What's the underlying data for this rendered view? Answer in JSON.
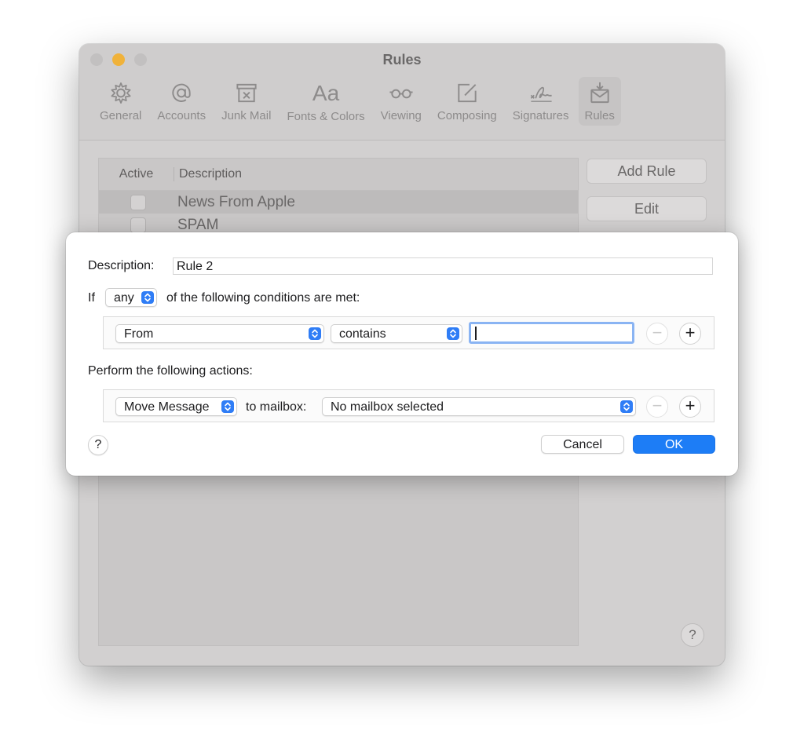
{
  "window": {
    "title": "Rules",
    "tabs": [
      {
        "label": "General",
        "icon": "gear-icon"
      },
      {
        "label": "Accounts",
        "icon": "at-sign-icon"
      },
      {
        "label": "Junk Mail",
        "icon": "junk-mail-icon"
      },
      {
        "label": "Fonts & Colors",
        "icon": "fonts-icon",
        "glyph": "Aa"
      },
      {
        "label": "Viewing",
        "icon": "glasses-icon"
      },
      {
        "label": "Composing",
        "icon": "compose-icon"
      },
      {
        "label": "Signatures",
        "icon": "signature-icon"
      },
      {
        "label": "Rules",
        "icon": "rules-envelope-icon",
        "active": true
      }
    ],
    "table": {
      "headers": {
        "active": "Active",
        "description": "Description"
      },
      "rows": [
        {
          "description": "News From Apple",
          "active": false,
          "selected": true
        },
        {
          "description": "SPAM",
          "active": false,
          "selected": false
        }
      ]
    },
    "buttons": {
      "add_rule": "Add Rule",
      "edit": "Edit",
      "help": "?"
    }
  },
  "sheet": {
    "description_label": "Description:",
    "description_value": "Rule 2",
    "if_label": "If",
    "match_value": "any",
    "conditions_suffix": "of the following conditions are met:",
    "condition": {
      "field": "From",
      "operator": "contains",
      "value": ""
    },
    "actions_label": "Perform the following actions:",
    "action": {
      "type": "Move Message",
      "to_label": "to mailbox:",
      "mailbox": "No mailbox selected"
    },
    "minus_glyph": "−",
    "plus_glyph": "+",
    "help": "?",
    "cancel": "Cancel",
    "ok": "OK"
  },
  "colors": {
    "accent": "#1d7df6",
    "focus_ring": "#8ab4f3",
    "minimize_button": "#f0b23a"
  }
}
